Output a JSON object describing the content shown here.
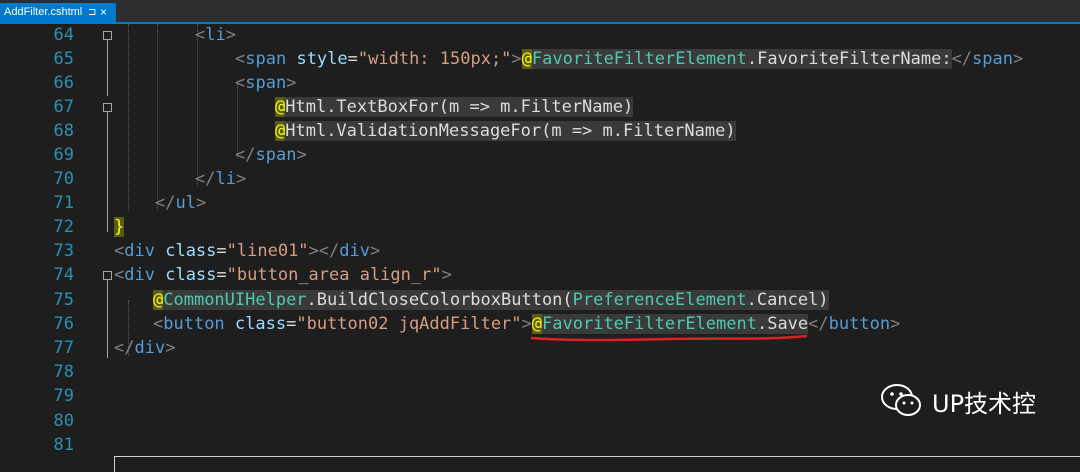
{
  "tab": {
    "title": "AddFilter.cshtml",
    "pin": "⊐",
    "close": "×"
  },
  "lines": [
    {
      "n": "64"
    },
    {
      "n": "65"
    },
    {
      "n": "66"
    },
    {
      "n": "67"
    },
    {
      "n": "68"
    },
    {
      "n": "69"
    },
    {
      "n": "70"
    },
    {
      "n": "71"
    },
    {
      "n": "72"
    },
    {
      "n": "73"
    },
    {
      "n": "74"
    },
    {
      "n": "75"
    },
    {
      "n": "76"
    },
    {
      "n": "77"
    },
    {
      "n": "78"
    },
    {
      "n": "79"
    },
    {
      "n": "80"
    },
    {
      "n": "81"
    }
  ],
  "code": {
    "l64_tag": "li",
    "l65_tag": "span",
    "l65_attr": "style",
    "l65_val": "\"width: 150px;\"",
    "l65_type": "FavoriteFilterElement",
    "l65_member": ".FavoriteFilterName:",
    "l65_close": "span",
    "l66_tag": "span",
    "l67_text": "Html.TextBoxFor(m => m.FilterName)",
    "l68_text": "Html.ValidationMessageFor(m => m.FilterName)",
    "l69_close": "span",
    "l70_close": "li",
    "l71_close": "ul",
    "l72_brace": "}",
    "l73_tag": "div",
    "l73_attr": "class",
    "l73_val": "\"line01\"",
    "l73_close": "div",
    "l74_tag": "div",
    "l74_attr": "class",
    "l74_val": "\"button_area align_r\"",
    "l75_type1": "CommonUIHelper",
    "l75_mid": ".BuildCloseColorboxButton(",
    "l75_type2": "PreferenceElement",
    "l75_end": ".Cancel)",
    "l76_tag": "button",
    "l76_attr": "class",
    "l76_val": "\"button02 jqAddFilter\"",
    "l76_type": "FavoriteFilterElement",
    "l76_member": ".Save",
    "l76_close": "button",
    "l77_close": "div",
    "razor": "@"
  },
  "watermark": {
    "icon": "wechat-icon",
    "text": "UP技术控"
  },
  "colors": {
    "accent": "#007acc",
    "background": "#1e1e1e",
    "line_number": "#2b91af",
    "squiggle": "#e02020"
  }
}
